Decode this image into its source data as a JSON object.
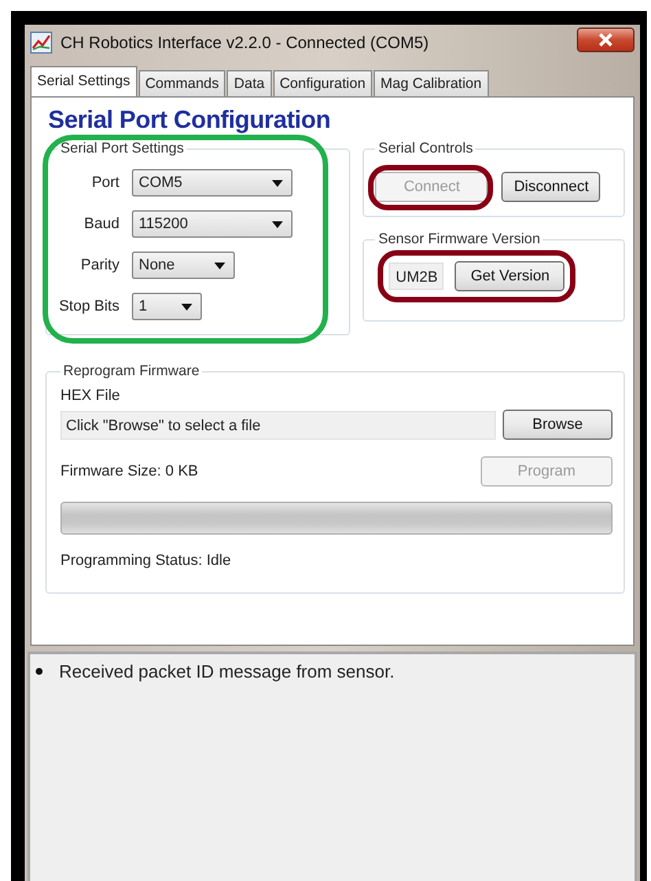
{
  "window": {
    "title": "CH Robotics Interface v2.2.0 - Connected (COM5)"
  },
  "tabs": [
    {
      "label": "Serial Settings",
      "selected": true
    },
    {
      "label": "Commands",
      "selected": false
    },
    {
      "label": "Data",
      "selected": false
    },
    {
      "label": "Configuration",
      "selected": false
    },
    {
      "label": "Mag Calibration",
      "selected": false
    }
  ],
  "heading": "Serial Port Configuration",
  "serial_port_settings": {
    "title": "Serial Port Settings",
    "fields": [
      {
        "label": "Port",
        "value": "COM5"
      },
      {
        "label": "Baud",
        "value": "115200"
      },
      {
        "label": "Parity",
        "value": "None"
      },
      {
        "label": "Stop Bits",
        "value": "1"
      }
    ]
  },
  "serial_controls": {
    "title": "Serial Controls",
    "buttons": [
      {
        "label": "Connect",
        "disabled": true
      },
      {
        "label": "Disconnect",
        "disabled": false
      }
    ]
  },
  "sensor_firmware_version": {
    "title": "Sensor Firmware Version",
    "value": "UM2B",
    "button": "Get Version"
  },
  "reprogram_firmware": {
    "title": "Reprogram Firmware",
    "hex_file_label": "HEX File",
    "hex_file_value": "Click \"Browse\" to select a file",
    "browse_button": "Browse",
    "firmware_size": "Firmware Size: 0 KB",
    "program_button": {
      "label": "Program",
      "disabled": true
    },
    "progress": {
      "level": 0
    },
    "status": "Programming Status: Idle"
  },
  "log": [
    "Received packet ID message from sensor."
  ],
  "annotations": [
    {
      "color": "#22b14c"
    },
    {
      "color": "#880015"
    },
    {
      "color": "#880015"
    }
  ]
}
